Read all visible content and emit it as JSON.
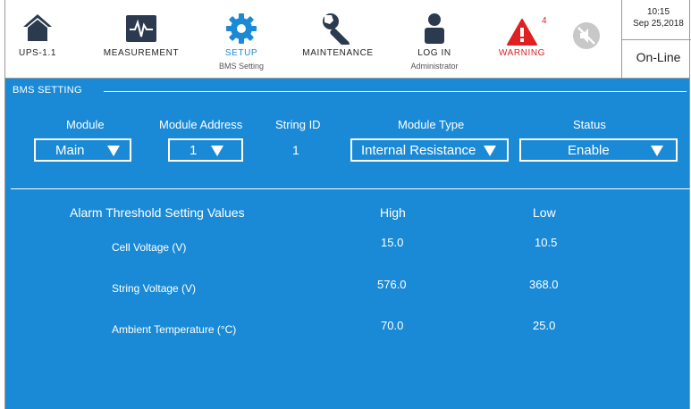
{
  "nav": {
    "ups": {
      "label": "UPS-1.1"
    },
    "measurement": {
      "label": "MEASUREMENT"
    },
    "setup": {
      "label": "SETUP",
      "sub": "BMS Setting"
    },
    "maintenance": {
      "label": "MAINTENANCE"
    },
    "login": {
      "label": "LOG IN",
      "sub": "Administrator"
    },
    "warning": {
      "label": "WARNING",
      "count": "4"
    },
    "mute": {
      "label": ""
    }
  },
  "status": {
    "time": "10:15",
    "date": "Sep 25,2018",
    "state": "On-Line"
  },
  "bms": {
    "section_title": "BMS SETTING",
    "headers": {
      "module": "Module",
      "module_address": "Module Address",
      "string_id": "String ID",
      "module_type": "Module Type",
      "status": "Status"
    },
    "values": {
      "module": "Main",
      "module_address": "1",
      "string_id": "1",
      "module_type": "Internal Resistance",
      "status": "Enable"
    }
  },
  "thresholds": {
    "title": "Alarm Threshold Setting Values",
    "high_label": "High",
    "low_label": "Low",
    "rows": [
      {
        "label": "Cell Voltage (V)",
        "high": "15.0",
        "low": "10.5"
      },
      {
        "label": "String Voltage (V)",
        "high": "576.0",
        "low": "368.0"
      },
      {
        "label": "Ambient Temperature (°C)",
        "high": "70.0",
        "low": "25.0"
      }
    ]
  },
  "colors": {
    "panel": "#1a8ad6",
    "nav_icon_dark": "#2b3a4e",
    "accent_blue": "#1a8ad6",
    "warning_red": "#e02020"
  }
}
